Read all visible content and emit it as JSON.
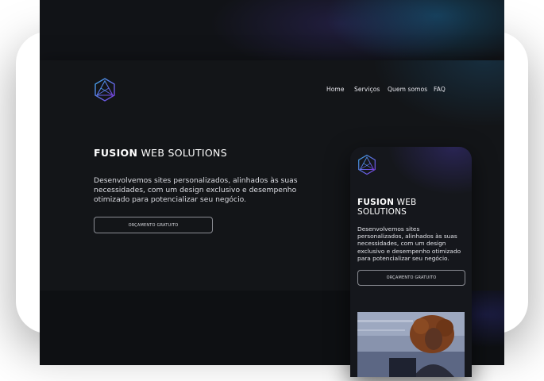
{
  "nav": {
    "items": [
      {
        "label": "Home"
      },
      {
        "label": "Serviços"
      },
      {
        "label": "Quem somos"
      },
      {
        "label": "FAQ"
      }
    ]
  },
  "logo": {
    "icon": "hexagon-triangle-logo-icon"
  },
  "hero": {
    "title_bold": "FUSION",
    "title_rest": " WEB SOLUTIONS",
    "description": "Desenvolvemos sites personalizados, alinhados às suas necessidades, com um design exclusivo e desempenho otimizado para potencializar seu negócio.",
    "cta_label": "ORÇAMENTO GRATUITO"
  },
  "mobile": {
    "title_bold": "FUSION",
    "title_rest": " WEB SOLUTIONS",
    "description": "Desenvolvemos sites personalizados, alinhados às suas necessidades, com um design exclusivo e desempenho otimizado para potencializar seu negócio.",
    "cta_label": "ORÇAMENTO GRATUITO",
    "photo": "woman-with-curly-hair-photo"
  },
  "colors": {
    "background": "#131518",
    "accent_blue": "#18628c",
    "accent_purple": "#5a3ec8",
    "text": "#ffffff"
  }
}
